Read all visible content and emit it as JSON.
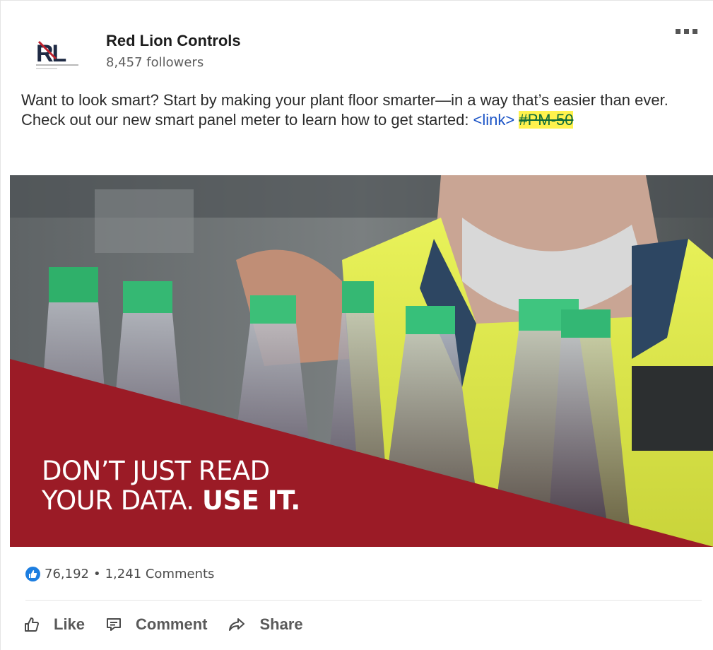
{
  "company": {
    "name": "Red Lion Controls",
    "followers": "8,457 followers",
    "logo_text": "RL"
  },
  "post": {
    "text": "Want to look smart? Start by making your plant floor smarter—in a way that’s easier than ever. Check out our new smart panel meter to learn how to get started: ",
    "link": "<link>",
    "hashtag": "#PM-50"
  },
  "hero": {
    "headline_line1": "DON’T JUST READ",
    "headline_line2_regular": "YOUR DATA. ",
    "headline_line2_bold": "USE IT.",
    "accent_color": "#9b1b26"
  },
  "stats": {
    "likes": "76,192",
    "separator": "•",
    "comments": "1,241 Comments"
  },
  "actions": {
    "like": "Like",
    "comment": "Comment",
    "share": "Share"
  },
  "icons": [
    "thumbs-up-icon",
    "comment-icon",
    "share-icon",
    "more-icon"
  ]
}
